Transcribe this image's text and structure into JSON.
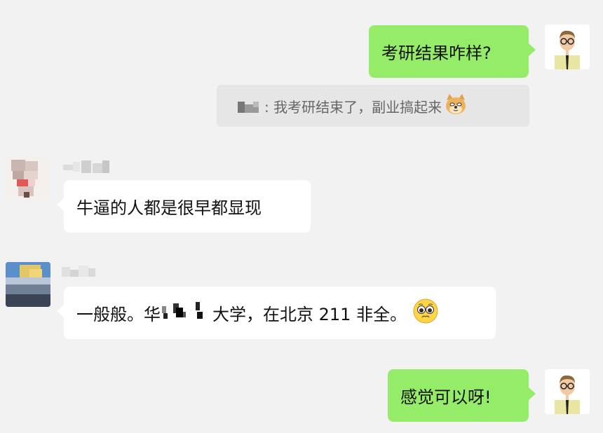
{
  "messages": [
    {
      "id": "m1",
      "sender": "me",
      "text": "考研结果咋样?"
    },
    {
      "id": "q1",
      "type": "quote",
      "text_suffix": ": 我考研结束了，副业搞起来",
      "emoji": "doge"
    },
    {
      "id": "m2",
      "sender": "other",
      "text": "牛逼的人都是很早都显现"
    },
    {
      "id": "m3",
      "sender": "other",
      "text_before": "一般般。华",
      "text_after": "大学，在北京 211 非全。",
      "emoji": "pleading-face"
    },
    {
      "id": "m4",
      "sender": "me",
      "text": "感觉可以呀!"
    }
  ],
  "colors": {
    "background": "#f2f2f2",
    "my_bubble": "#95ec69",
    "other_bubble": "#ffffff",
    "quote_bg": "#e6e6e6"
  }
}
